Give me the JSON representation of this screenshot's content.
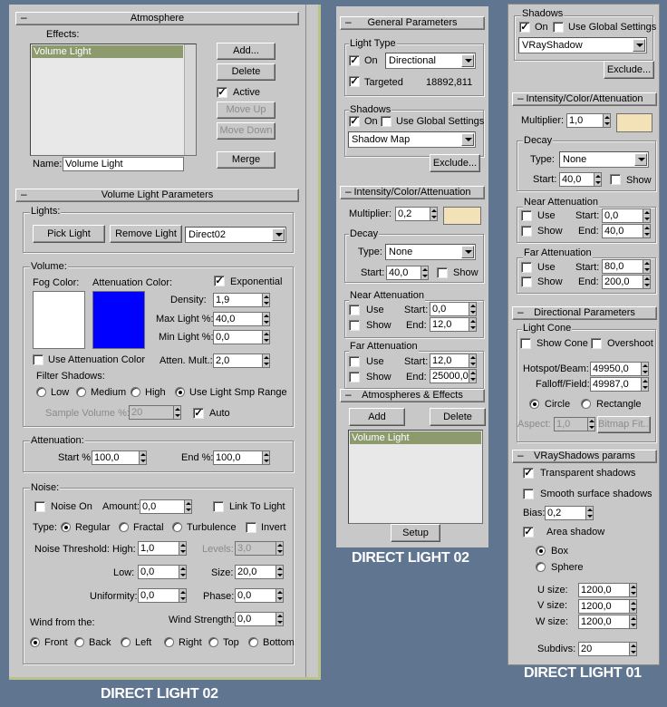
{
  "left": {
    "atmosphere": {
      "title": "Atmosphere",
      "effects_label": "Effects:",
      "effect_item": "Volume Light",
      "add": "Add...",
      "delete": "Delete",
      "active": "Active",
      "move_up": "Move Up",
      "move_down": "Move Down",
      "name_label": "Name:",
      "name_value": "Volume Light",
      "merge": "Merge"
    },
    "vlp": {
      "title": "Volume Light Parameters",
      "lights_label": "Lights:",
      "pick_light": "Pick Light",
      "remove_light": "Remove Light",
      "light_value": "Direct02",
      "volume_label": "Volume:",
      "fog_color": "Fog Color:",
      "atten_color": "Attenuation Color:",
      "exponential": "Exponential",
      "density_label": "Density:",
      "density": "1,9",
      "max_light_label": "Max Light %:",
      "max_light": "40,0",
      "min_light_label": "Min Light %:",
      "min_light": "0,0",
      "use_atten_color": "Use Attenuation Color",
      "atten_mult_label": "Atten. Mult.:",
      "atten_mult": "2,0",
      "filter_shadows": "Filter Shadows:",
      "low": "Low",
      "medium": "Medium",
      "high": "High",
      "use_smp": "Use Light Smp Range",
      "sample_volume_label": "Sample Volume %:",
      "sample_volume": "20",
      "auto": "Auto",
      "attenuation_label": "Attenuation:",
      "start_label": "Start %:",
      "start": "100,0",
      "end_label": "End %:",
      "end": "100,0",
      "noise_label": "Noise:",
      "noise_on": "Noise On",
      "amount_label": "Amount:",
      "amount": "0,0",
      "link_to_light": "Link To Light",
      "type_label": "Type:",
      "regular": "Regular",
      "fractal": "Fractal",
      "turbulence": "Turbulence",
      "invert": "Invert",
      "noise_threshold": "Noise Threshold:",
      "high_label": "High:",
      "high_val": "1,0",
      "levels_label": "Levels:",
      "levels": "3,0",
      "low_label": "Low:",
      "low_val": "0,0",
      "size_label": "Size:",
      "size": "20,0",
      "uniformity_label": "Uniformity:",
      "uniformity": "0,0",
      "phase_label": "Phase:",
      "phase": "0,0",
      "wind_from": "Wind from the:",
      "wind_strength_label": "Wind Strength:",
      "wind_strength": "0,0",
      "front": "Front",
      "back": "Back",
      "left": "Left",
      "right": "Right",
      "top": "Top",
      "bottom": "Bottom"
    },
    "caption": "DIRECT LIGHT 02"
  },
  "middle": {
    "general": {
      "title": "General Parameters",
      "light_type": "Light Type",
      "on": "On",
      "type_value": "Directional",
      "targeted": "Targeted",
      "distance": "18892,811",
      "shadows": "Shadows",
      "use_global": "Use Global Settings",
      "shadow_value": "Shadow Map",
      "exclude": "Exclude..."
    },
    "ica": {
      "title": "Intensity/Color/Attenuation",
      "multiplier_label": "Multiplier:",
      "multiplier": "0,2",
      "decay": "Decay",
      "type_label": "Type:",
      "type_value": "None",
      "start_label": "Start:",
      "start": "40,0",
      "show": "Show",
      "near": "Near Attenuation",
      "use": "Use",
      "start_near": "0,0",
      "end_label": "End:",
      "end_near": "12,0",
      "far": "Far Attenuation",
      "start_far": "12,0",
      "end_far": "25000,0"
    },
    "atmos": {
      "title": "Atmospheres & Effects",
      "add": "Add",
      "delete": "Delete",
      "item": "Volume Light",
      "setup": "Setup"
    },
    "caption": "DIRECT LIGHT 02"
  },
  "right": {
    "shadows": {
      "label": "Shadows",
      "on": "On",
      "use_global": "Use Global Settings",
      "value": "VRayShadow",
      "exclude": "Exclude..."
    },
    "ica": {
      "title": "Intensity/Color/Attenuation",
      "multiplier_label": "Multiplier:",
      "multiplier": "1,0",
      "decay": "Decay",
      "type_label": "Type:",
      "type_value": "None",
      "start_label": "Start:",
      "start": "40,0",
      "show": "Show",
      "near": "Near Attenuation",
      "use": "Use",
      "start_near": "0,0",
      "end_label": "End:",
      "end_near": "40,0",
      "far": "Far Attenuation",
      "start_far": "80,0",
      "end_far": "200,0"
    },
    "directional": {
      "title": "Directional Parameters",
      "light_cone": "Light Cone",
      "show_cone": "Show Cone",
      "overshoot": "Overshoot",
      "hotspot_label": "Hotspot/Beam:",
      "hotspot": "49950,0",
      "falloff_label": "Falloff/Field:",
      "falloff": "49987,0",
      "circle": "Circle",
      "rectangle": "Rectangle",
      "aspect_label": "Aspect:",
      "aspect": "1,0",
      "bitmap_fit": "Bitmap Fit..."
    },
    "vray": {
      "title": "VRayShadows params",
      "transparent": "Transparent shadows",
      "smooth": "Smooth surface shadows",
      "bias_label": "Bias:",
      "bias": "0,2",
      "area": "Area shadow",
      "box": "Box",
      "sphere": "Sphere",
      "u_label": "U size:",
      "u": "1200,0",
      "v_label": "V size:",
      "v": "1200,0",
      "w_label": "W size:",
      "w": "1200,0",
      "subdivs_label": "Subdivs:",
      "subdivs": "20"
    },
    "caption": "DIRECT LIGHT 01"
  },
  "colors": {
    "fog": "#ffffff",
    "attenuation": "#0000ff",
    "light_color": "#f3e1b7",
    "background": "#5f7590"
  }
}
